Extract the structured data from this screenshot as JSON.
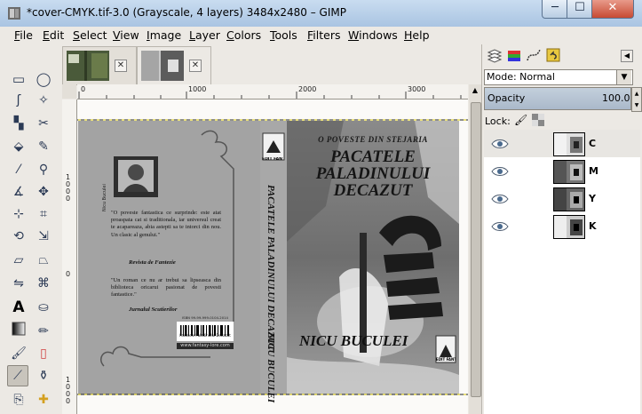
{
  "window": {
    "title": "*cover-CMYK.tif-3.0 (Grayscale, 4 layers) 3484x2480 – GIMP",
    "minimize": "─",
    "maximize": "☐",
    "close": "✕"
  },
  "menubar": {
    "items": [
      {
        "key": "F",
        "rest": "ile"
      },
      {
        "key": "E",
        "rest": "dit"
      },
      {
        "key": "S",
        "rest": "elect"
      },
      {
        "key": "V",
        "rest": "iew"
      },
      {
        "key": "I",
        "rest": "mage"
      },
      {
        "key": "L",
        "rest": "ayer"
      },
      {
        "key": "C",
        "rest": "olors"
      },
      {
        "key": "T",
        "rest": "ools"
      },
      {
        "key": "F",
        "rest": "ilters"
      },
      {
        "key": "W",
        "rest": "indows"
      },
      {
        "key": "H",
        "rest": "elp"
      }
    ]
  },
  "rulers": {
    "top": [
      "0",
      "1000",
      "2000",
      "3000"
    ],
    "left": [
      "1000",
      "0",
      "1000"
    ]
  },
  "cover": {
    "spine_title": "PACATELE PALADINULUI DECAZUT",
    "spine_author": "NICU BUCULEI",
    "publisher_badge": "EDIT FANTASY",
    "front_tagline": "O POVESTE DIN STEJARIA",
    "front_title_1": "PACATELE",
    "front_title_2": "PALADINULUI",
    "front_title_3": "DECAZUT",
    "front_author": "NICU BUCULEI",
    "back_photo_caption": "Nicu Buculei",
    "quote1": "\"O poveste fantastica ce surprinde: este atat proaspata cat si traditionala, iar universul creat te acapareaza, abia astepti sa te intorci din nou. Un clasic al genului.\"",
    "quote1_source": "Revista de Fantezie",
    "quote2": "\"Un roman ce nu ar trebui sa lipseasca din biblioteca oricarui pasionat de povesti fantastice.\"",
    "quote2_source": "Jurnalul Scutierilor",
    "isbn": "ISBN 99-99-999-0104-2014",
    "barcode_caption": "Pacatele Paladinului Decazut",
    "url": "www.fantasy-lore.com"
  },
  "dock": {
    "mode_label": "Mode: Normal",
    "opacity_label": "Opacity",
    "opacity_value": "100.0",
    "lock_label": "Lock:",
    "layers": [
      {
        "name": "C"
      },
      {
        "name": "M"
      },
      {
        "name": "Y"
      },
      {
        "name": "K"
      }
    ]
  },
  "colors": {
    "titlebar": "#b9cfe8",
    "close_button": "#c74a33",
    "canvas_gray": "#9a9a9a"
  }
}
